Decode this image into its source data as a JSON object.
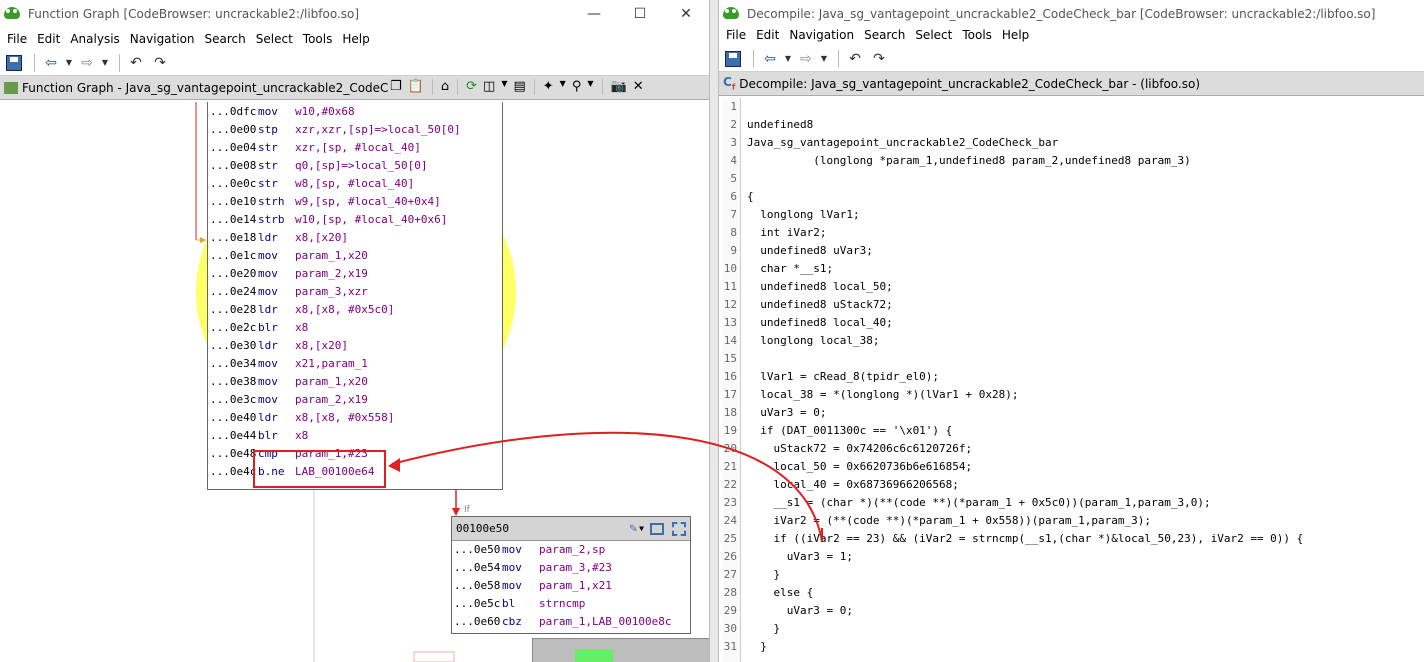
{
  "left_window": {
    "title": "Function Graph [CodeBrowser: uncrackable2:/libfoo.so]",
    "menu": [
      "File",
      "Edit",
      "Analysis",
      "Navigation",
      "Search",
      "Select",
      "Tools",
      "Help"
    ],
    "panel_title": "Function Graph - Java_sg_vantagepoint_uncrackable2_CodeC...",
    "block_a": [
      {
        "addr": "...0dfc",
        "mn": "mov",
        "ops": "w10,#0x68"
      },
      {
        "addr": "...0e00",
        "mn": "stp",
        "ops": "xzr,xzr,[sp]=>local_50[0]"
      },
      {
        "addr": "...0e04",
        "mn": "str",
        "ops": "xzr,[sp, #local_40]"
      },
      {
        "addr": "...0e08",
        "mn": "str",
        "ops": "q0,[sp]=>local_50[0]"
      },
      {
        "addr": "...0e0c",
        "mn": "str",
        "ops": "w8,[sp, #local_40]"
      },
      {
        "addr": "...0e10",
        "mn": "strh",
        "ops": "w9,[sp, #local_40+0x4]"
      },
      {
        "addr": "...0e14",
        "mn": "strb",
        "ops": "w10,[sp, #local_40+0x6]"
      },
      {
        "addr": "...0e18",
        "mn": "ldr",
        "ops": "x8,[x20]"
      },
      {
        "addr": "...0e1c",
        "mn": "mov",
        "ops": "param_1,x20"
      },
      {
        "addr": "...0e20",
        "mn": "mov",
        "ops": "param_2,x19"
      },
      {
        "addr": "...0e24",
        "mn": "mov",
        "ops": "param_3,xzr"
      },
      {
        "addr": "...0e28",
        "mn": "ldr",
        "ops": "x8,[x8, #0x5c0]"
      },
      {
        "addr": "...0e2c",
        "mn": "blr",
        "ops": "x8"
      },
      {
        "addr": "...0e30",
        "mn": "ldr",
        "ops": "x8,[x20]"
      },
      {
        "addr": "...0e34",
        "mn": "mov",
        "ops": "x21,param_1"
      },
      {
        "addr": "...0e38",
        "mn": "mov",
        "ops": "param_1,x20"
      },
      {
        "addr": "...0e3c",
        "mn": "mov",
        "ops": "param_2,x19"
      },
      {
        "addr": "...0e40",
        "mn": "ldr",
        "ops": "x8,[x8, #0x558]"
      },
      {
        "addr": "...0e44",
        "mn": "blr",
        "ops": "x8"
      },
      {
        "addr": "...0e48",
        "mn": "cmp",
        "ops": "param_1,#23"
      },
      {
        "addr": "...0e4c",
        "mn": "b.ne",
        "ops": "LAB_00100e64"
      }
    ],
    "block_b_title": "00100e50",
    "block_b": [
      {
        "addr": "...0e50",
        "mn": "mov",
        "ops": "param_2,sp"
      },
      {
        "addr": "...0e54",
        "mn": "mov",
        "ops": "param_3,#23"
      },
      {
        "addr": "...0e58",
        "mn": "mov",
        "ops": "param_1,x21"
      },
      {
        "addr": "...0e5c",
        "mn": "bl",
        "ops": "strncmp"
      },
      {
        "addr": "...0e60",
        "mn": "cbz",
        "ops": "param_1,LAB_00100e8c"
      }
    ],
    "edge_label": "If"
  },
  "right_window": {
    "title": "Decompile: Java_sg_vantagepoint_uncrackable2_CodeCheck_bar [CodeBrowser: uncrackable2:/libfoo.so]",
    "menu": [
      "File",
      "Edit",
      "Navigation",
      "Search",
      "Select",
      "Tools",
      "Help"
    ],
    "panel_title": "Decompile: Java_sg_vantagepoint_uncrackable2_CodeCheck_bar -  (libfoo.so)",
    "lines": [
      "",
      "undefined8",
      "Java_sg_vantagepoint_uncrackable2_CodeCheck_bar",
      "          (longlong *param_1,undefined8 param_2,undefined8 param_3)",
      "",
      "{",
      "  longlong lVar1;",
      "  int iVar2;",
      "  undefined8 uVar3;",
      "  char *__s1;",
      "  undefined8 local_50;",
      "  undefined8 uStack72;",
      "  undefined8 local_40;",
      "  longlong local_38;",
      "",
      "  lVar1 = cRead_8(tpidr_el0);",
      "  local_38 = *(longlong *)(lVar1 + 0x28);",
      "  uVar3 = 0;",
      "  if (DAT_0011300c == '\\x01') {",
      "    uStack72 = 0x74206c6c6120726f;",
      "    local_50 = 0x6620736b6e616854;",
      "    local_40 = 0x68736966206568;",
      "    __s1 = (char *)(**(code **)(*param_1 + 0x5c0))(param_1,param_3,0);",
      "    iVar2 = (**(code **)(*param_1 + 0x558))(param_1,param_3);",
      "    if ((iVar2 == 23) && (iVar2 = strncmp(__s1,(char *)&local_50,23), iVar2 == 0)) {",
      "      uVar3 = 1;",
      "    }",
      "    else {",
      "      uVar3 = 0;",
      "    }",
      "  }"
    ]
  },
  "colors": {
    "highlight": "#ffff66",
    "annotation": "#e02020"
  }
}
